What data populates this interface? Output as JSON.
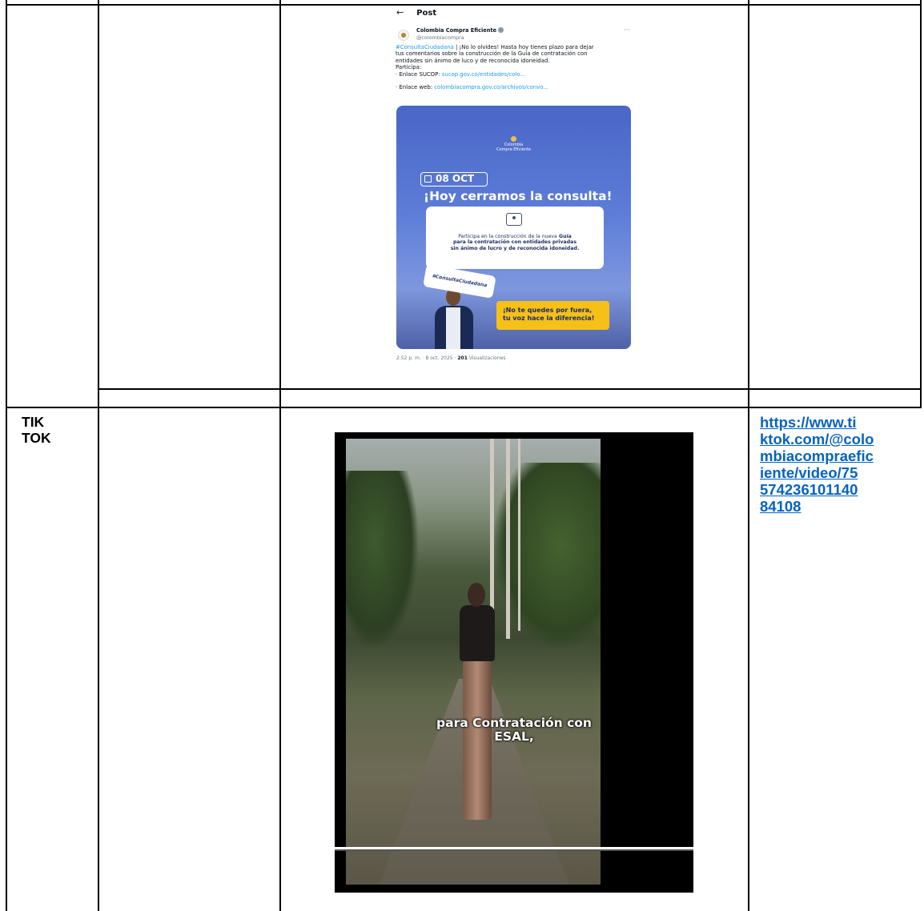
{
  "tweet": {
    "back_arrow": "←",
    "header": "Post",
    "author_name": "Colombia Compra Eficiente",
    "author_handle": "@colombiacompra",
    "more": "···",
    "hashtag": "#ConsultaCiudadana",
    "text_line1_rest": " | ¡No lo olvides! Hasta hoy tienes plazo para dejar",
    "text_line2": "tus comentarios sobre la construcción de la Guía de contratación con",
    "text_line3": "entidades sin ánimo de luco y de reconocida idoneidad.",
    "text_line4": "Participa:",
    "sucop_label": "· Enlace SUCOP: ",
    "sucop_link": "sucop.gov.co/entidades/colo...",
    "web_label": "· Enlace web: ",
    "web_link": "colombiacompra.gov.co/archivos/convo...",
    "footer_time": "2:52 p. m. · 8 oct. 2025 · ",
    "footer_views": "201",
    "footer_views_label": " Visualizaciones",
    "image": {
      "logo_line1": "Colombia",
      "logo_line2": "Compra Eficiente",
      "date": "08 OCT",
      "title": "¡Hoy cerramos la consulta!",
      "card_line1": "Participa en la construcción de la nueva",
      "card_line1_bold": " Guía",
      "card_line2": "para la contratación con entidades privadas",
      "card_line3": "sin ánimo de lucro y de reconocida idoneidad.",
      "sign": "#ConsultaCiudadana",
      "banner_line1": "¡No te quedes por fuera,",
      "banner_line2": "tu voz hace la diferencia!"
    }
  },
  "tiktok_row": {
    "label_line1": "TIK",
    "label_line2": "TOK",
    "url_lines": [
      "https://www.ti",
      "ktok.com/@colo",
      "mbiacompraefic",
      "iente/video/75",
      "574236101140",
      "84108"
    ],
    "video_caption_line1": "para Contratación con",
    "video_caption_line2": "ESAL,",
    "video_progress": 1.0
  }
}
